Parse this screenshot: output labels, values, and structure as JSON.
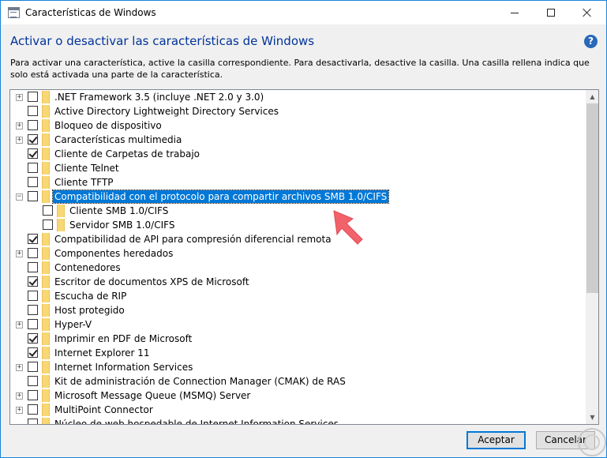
{
  "window": {
    "title": "Características de Windows"
  },
  "header": {
    "heading": "Activar o desactivar las características de Windows",
    "description": "Para activar una característica, active la casilla correspondiente. Para desactivarla, desactive la casilla. Una casilla rellena indica que solo está activada una parte de la característica."
  },
  "icons": {
    "help": "?",
    "expand": "+",
    "collapse": "−",
    "scroll_up": "▲",
    "scroll_down": "▼"
  },
  "features": [
    {
      "label": ".NET Framework 3.5 (incluye .NET 2.0 y 3.0)",
      "checked": false,
      "expander": "plus",
      "level": 0
    },
    {
      "label": "Active Directory Lightweight Directory Services",
      "checked": false,
      "expander": "none",
      "level": 0
    },
    {
      "label": "Bloqueo de dispositivo",
      "checked": false,
      "expander": "plus",
      "level": 0
    },
    {
      "label": "Características multimedia",
      "checked": true,
      "expander": "plus",
      "level": 0
    },
    {
      "label": "Cliente de Carpetas de trabajo",
      "checked": true,
      "expander": "none",
      "level": 0
    },
    {
      "label": "Cliente Telnet",
      "checked": false,
      "expander": "none",
      "level": 0
    },
    {
      "label": "Cliente TFTP",
      "checked": false,
      "expander": "none",
      "level": 0
    },
    {
      "label": "Compatibilidad con el protocolo para compartir archivos SMB 1.0/CIFS",
      "checked": false,
      "expander": "minus",
      "level": 0,
      "selected": true
    },
    {
      "label": "Cliente SMB 1.0/CIFS",
      "checked": false,
      "expander": "none",
      "level": 1
    },
    {
      "label": "Servidor SMB 1.0/CIFS",
      "checked": false,
      "expander": "none",
      "level": 1
    },
    {
      "label": "Compatibilidad de API para compresión diferencial remota",
      "checked": true,
      "expander": "none",
      "level": 0
    },
    {
      "label": "Componentes heredados",
      "checked": false,
      "expander": "plus",
      "level": 0
    },
    {
      "label": "Contenedores",
      "checked": false,
      "expander": "none",
      "level": 0
    },
    {
      "label": "Escritor de documentos XPS de Microsoft",
      "checked": true,
      "expander": "none",
      "level": 0
    },
    {
      "label": "Escucha de RIP",
      "checked": false,
      "expander": "none",
      "level": 0
    },
    {
      "label": "Host protegido",
      "checked": false,
      "expander": "none",
      "level": 0
    },
    {
      "label": "Hyper-V",
      "checked": false,
      "expander": "plus",
      "level": 0
    },
    {
      "label": "Imprimir en PDF de Microsoft",
      "checked": true,
      "expander": "none",
      "level": 0
    },
    {
      "label": "Internet Explorer 11",
      "checked": true,
      "expander": "none",
      "level": 0
    },
    {
      "label": "Internet Information Services",
      "checked": false,
      "expander": "plus",
      "level": 0
    },
    {
      "label": "Kit de administración de Connection Manager (CMAK) de RAS",
      "checked": false,
      "expander": "none",
      "level": 0
    },
    {
      "label": "Microsoft Message Queue (MSMQ) Server",
      "checked": false,
      "expander": "plus",
      "level": 0
    },
    {
      "label": "MultiPoint Connector",
      "checked": false,
      "expander": "plus",
      "level": 0
    },
    {
      "label": "Núcleo de web hospedable de Internet Information Services",
      "checked": false,
      "expander": "none",
      "level": 0,
      "cut": true
    }
  ],
  "buttons": {
    "ok": "Aceptar",
    "cancel": "Cancelar"
  },
  "colors": {
    "selection": "#0078d7",
    "heading": "#003399",
    "folder": "#f8d775",
    "arrow": "#f2626a"
  }
}
